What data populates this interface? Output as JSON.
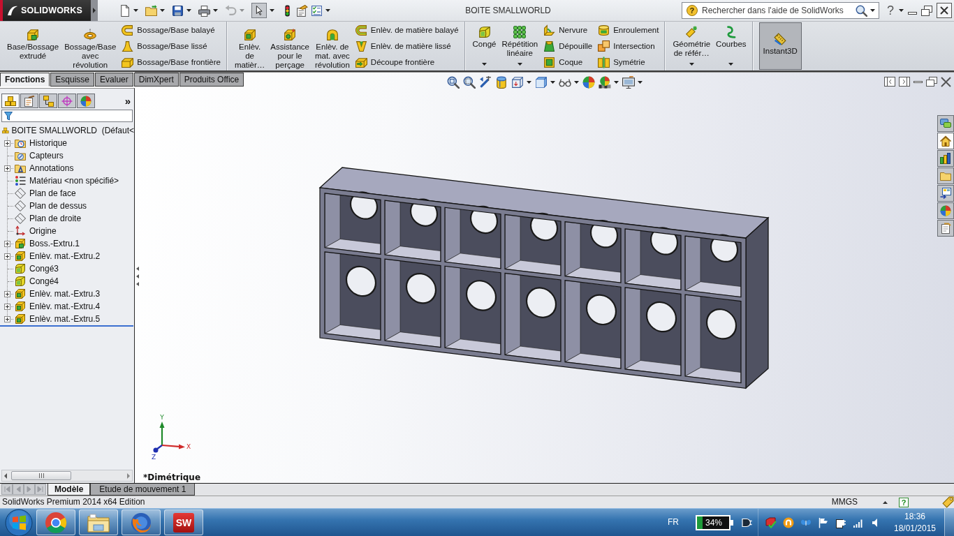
{
  "app": {
    "logo": "SOLIDWORKS",
    "title": "BOITE SMALLWORLD"
  },
  "quick_access": [
    {
      "kind": "new",
      "selected": false,
      "disabled": false
    },
    {
      "kind": "open",
      "selected": false,
      "disabled": false
    },
    {
      "kind": "save",
      "selected": false,
      "disabled": false
    },
    {
      "kind": "print",
      "selected": false,
      "disabled": false
    },
    {
      "kind": "undo",
      "selected": false,
      "disabled": true
    },
    {
      "kind": "select",
      "selected": true,
      "disabled": false
    },
    {
      "kind": "rebuild",
      "selected": false,
      "disabled": false
    },
    {
      "kind": "file-properties",
      "selected": false,
      "disabled": false
    },
    {
      "kind": "options",
      "selected": false,
      "disabled": false
    }
  ],
  "search": {
    "help_mark": "?",
    "placeholder": "Rechercher dans l'aide de SolidWorks"
  },
  "help_button": {
    "label": "?"
  },
  "ribbon": {
    "groups": [
      {
        "large": [
          {
            "kind": "extruded-boss",
            "label": "Base/Bossage\nextrudé",
            "dropdown": false,
            "selected": false
          },
          {
            "kind": "revolved-boss",
            "label": "Bossage/Base\navec\nrévolution",
            "dropdown": false,
            "selected": false
          }
        ],
        "columns": [
          [
            {
              "kind": "swept-boss",
              "label": "Bossage/Base balayé"
            },
            {
              "kind": "lofted-boss",
              "label": "Bossage/Base lissé"
            },
            {
              "kind": "boundary-boss",
              "label": "Bossage/Base frontière"
            }
          ]
        ]
      },
      {
        "large": [
          {
            "kind": "extruded-cut",
            "label": "Enlèv.\nde\nmatièr…",
            "dropdown": false,
            "selected": false
          },
          {
            "kind": "hole-wizard",
            "label": "Assistance\npour le\nperçage",
            "dropdown": false,
            "selected": false
          },
          {
            "kind": "revolved-cut",
            "label": "Enlèv. de\nmat. avec\nrévolution",
            "dropdown": false,
            "selected": false
          }
        ],
        "columns": [
          [
            {
              "kind": "swept-cut",
              "label": "Enlèv. de matière balayé"
            },
            {
              "kind": "lofted-cut",
              "label": "Enlèv. de matière lissé"
            },
            {
              "kind": "boundary-cut",
              "label": "Découpe frontière"
            }
          ]
        ]
      },
      {
        "large": [
          {
            "kind": "fillet",
            "label": "Congé",
            "dropdown": true,
            "selected": false
          },
          {
            "kind": "linear-pattern",
            "label": "Répétition\nlinéaire",
            "dropdown": true,
            "selected": false
          }
        ],
        "columns": [
          [
            {
              "kind": "rib",
              "label": "Nervure"
            },
            {
              "kind": "draft",
              "label": "Dépouille"
            },
            {
              "kind": "shell",
              "label": "Coque"
            }
          ],
          [
            {
              "kind": "wrap",
              "label": "Enroulement"
            },
            {
              "kind": "intersect",
              "label": "Intersection"
            },
            {
              "kind": "mirror",
              "label": "Symétrie"
            }
          ]
        ]
      },
      {
        "large": [
          {
            "kind": "reference-geometry",
            "label": "Géométrie\nde référ…",
            "dropdown": true,
            "selected": false
          },
          {
            "kind": "curves",
            "label": "Courbes",
            "dropdown": true,
            "selected": false
          }
        ]
      },
      {
        "large": [
          {
            "kind": "instant3d",
            "label": "Instant3D",
            "dropdown": false,
            "selected": true
          }
        ]
      }
    ]
  },
  "command_tabs": [
    {
      "label": "Fonctions",
      "selected": true
    },
    {
      "label": "Esquisse",
      "selected": false
    },
    {
      "label": "Evaluer",
      "selected": false
    },
    {
      "label": "DimXpert",
      "selected": false
    },
    {
      "label": "Produits Office",
      "selected": false
    }
  ],
  "feature_manager": {
    "tabs": [
      {
        "kind": "feature-manager",
        "selected": true
      },
      {
        "kind": "property-manager",
        "selected": false
      },
      {
        "kind": "configuration-manager",
        "selected": false
      },
      {
        "kind": "dimxpert",
        "selected": false
      },
      {
        "kind": "display-manager",
        "selected": false
      }
    ],
    "more": "»",
    "tree": {
      "kind": "part",
      "label": "BOITE SMALLWORLD  (Défaut<",
      "children": [
        {
          "kind": "history",
          "label": "Historique",
          "expandable": true,
          "expanded": false
        },
        {
          "kind": "sensors",
          "label": "Capteurs",
          "expandable": false
        },
        {
          "kind": "annotations",
          "label": "Annotations",
          "expandable": true,
          "expanded": false
        },
        {
          "kind": "material",
          "label": "Matériau <non spécifié>",
          "expandable": false
        },
        {
          "kind": "plane",
          "label": "Plan de face",
          "expandable": false
        },
        {
          "kind": "plane",
          "label": "Plan de dessus",
          "expandable": false
        },
        {
          "kind": "plane",
          "label": "Plan de droite",
          "expandable": false
        },
        {
          "kind": "origin",
          "label": "Origine",
          "expandable": false
        },
        {
          "kind": "boss",
          "label": "Boss.-Extru.1",
          "expandable": true,
          "expanded": false
        },
        {
          "kind": "cut",
          "label": "Enlèv. mat.-Extru.2",
          "expandable": true,
          "expanded": false
        },
        {
          "kind": "fillet",
          "label": "Congé3",
          "expandable": false
        },
        {
          "kind": "fillet",
          "label": "Congé4",
          "expandable": false
        },
        {
          "kind": "cut",
          "label": "Enlèv. mat.-Extru.3",
          "expandable": true,
          "expanded": false
        },
        {
          "kind": "cut",
          "label": "Enlèv. mat.-Extru.4",
          "expandable": true,
          "expanded": false
        },
        {
          "kind": "cut",
          "label": "Enlèv. mat.-Extru.5",
          "expandable": true,
          "expanded": false
        }
      ]
    }
  },
  "viewport": {
    "view_name": "*Dimétrique",
    "triad": {
      "x": "X",
      "y": "Y",
      "z": "Z"
    },
    "task_pane": [
      {
        "kind": "resources",
        "selected": false
      },
      {
        "kind": "home",
        "selected": true
      },
      {
        "kind": "design-library",
        "selected": false
      },
      {
        "kind": "file-explorer",
        "selected": false
      },
      {
        "kind": "view-palette",
        "selected": false
      },
      {
        "kind": "appearances",
        "selected": false
      },
      {
        "kind": "custom-properties",
        "selected": false
      }
    ]
  },
  "model_tabs": [
    {
      "label": "Modèle",
      "selected": true
    },
    {
      "label": "Etude de mouvement 1",
      "selected": false
    }
  ],
  "status_bar": {
    "text": "SolidWorks Premium 2014 x64 Edition",
    "units": "MMGS",
    "help_mark": "?"
  },
  "taskbar": {
    "apps": [
      {
        "kind": "chrome"
      },
      {
        "kind": "explorer"
      },
      {
        "kind": "firefox"
      },
      {
        "kind": "solidworks",
        "label": "SW"
      }
    ],
    "language": "FR",
    "battery": "34%",
    "time": "18:36",
    "date": "18/01/2015"
  }
}
